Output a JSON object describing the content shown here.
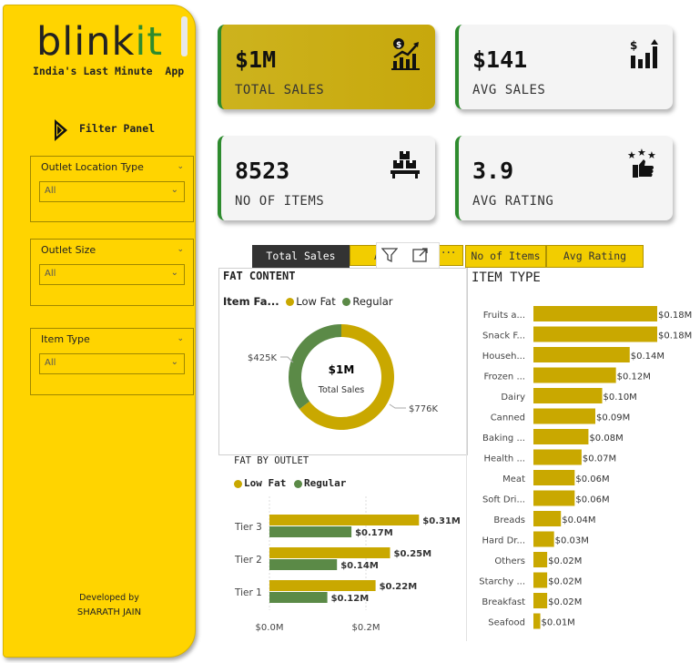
{
  "sidebar": {
    "logo_part1": "blink",
    "logo_part2": "it",
    "tagline": "India's Last Minute  App",
    "filter_panel_label": "Filter Panel",
    "slicers": [
      {
        "title": "Outlet Location Type",
        "value": "All"
      },
      {
        "title": "Outlet Size",
        "value": "All"
      },
      {
        "title": "Item Type",
        "value": "All"
      }
    ],
    "developed_by": "Developed by",
    "developer": "SHARATH JAIN"
  },
  "kpis": [
    {
      "value": "$1M",
      "label": "TOTAL SALES",
      "icon": "growth-chart-icon"
    },
    {
      "value": "$141",
      "label": "AVG SALES",
      "icon": "bar-chart-icon"
    },
    {
      "value": "8523",
      "label": "NO OF ITEMS",
      "icon": "boxes-icon"
    },
    {
      "value": "3.9",
      "label": "AVG RATING",
      "icon": "rating-stars-icon"
    }
  ],
  "tabs": {
    "total_sales": "Total Sales",
    "avg_sales": "A",
    "no_of_items": "No of Items",
    "avg_rating": "Avg Rating"
  },
  "colors": {
    "yellow": "#FFD400",
    "gold": "#C9A800",
    "green": "#5B8A47",
    "dark": "#333333"
  },
  "chart_data": [
    {
      "type": "pie",
      "title": "FAT CONTENT",
      "legend_title": "Item Fa...",
      "categories": [
        "Low Fat",
        "Regular"
      ],
      "values": [
        776,
        425
      ],
      "value_labels": [
        "$776K",
        "$425K"
      ],
      "center_value": "$1M",
      "center_label": "Total Sales"
    },
    {
      "type": "bar",
      "title": "FAT BY OUTLET",
      "categories": [
        "Tier 3",
        "Tier 2",
        "Tier 1"
      ],
      "series": [
        {
          "name": "Low Fat",
          "values": [
            0.31,
            0.25,
            0.22
          ],
          "labels": [
            "$0.31M",
            "$0.25M",
            "$0.22M"
          ]
        },
        {
          "name": "Regular",
          "values": [
            0.17,
            0.14,
            0.12
          ],
          "labels": [
            "$0.17M",
            "$0.14M",
            "$0.12M"
          ]
        }
      ],
      "x_ticks": [
        "$0.0M",
        "$0.2M"
      ],
      "xlim": [
        0,
        0.36
      ]
    },
    {
      "type": "bar",
      "title": "ITEM TYPE",
      "categories": [
        "Fruits a...",
        "Snack F...",
        "Househ...",
        "Frozen ...",
        "Dairy",
        "Canned",
        "Baking ...",
        "Health ...",
        "Meat",
        "Soft Dri...",
        "Breads",
        "Hard Dr...",
        "Others",
        "Starchy ...",
        "Breakfast",
        "Seafood"
      ],
      "values": [
        0.18,
        0.18,
        0.14,
        0.12,
        0.1,
        0.09,
        0.08,
        0.07,
        0.06,
        0.06,
        0.04,
        0.03,
        0.02,
        0.02,
        0.02,
        0.01
      ],
      "labels": [
        "$0.18M",
        "$0.18M",
        "$0.14M",
        "$0.12M",
        "$0.10M",
        "$0.09M",
        "$0.08M",
        "$0.07M",
        "$0.06M",
        "$0.06M",
        "$0.04M",
        "$0.03M",
        "$0.02M",
        "$0.02M",
        "$0.02M",
        "$0.01M"
      ]
    }
  ]
}
